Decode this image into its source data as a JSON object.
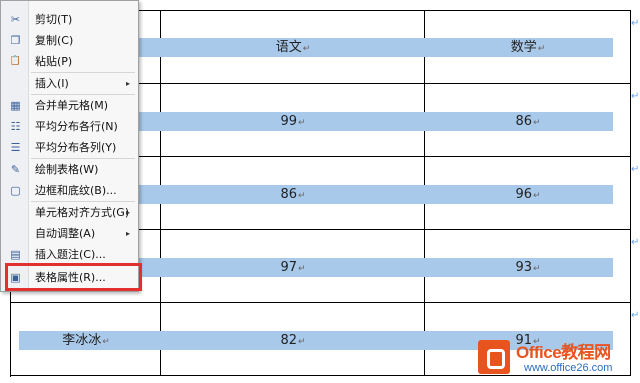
{
  "table": {
    "headers": [
      "语文",
      "数学"
    ],
    "rows": [
      {
        "name": "",
        "chinese": "99",
        "math": "86"
      },
      {
        "name": "",
        "chinese": "86",
        "math": "96"
      },
      {
        "name": "",
        "chinese": "97",
        "math": "93"
      },
      {
        "name": "李冰冰",
        "chinese": "82",
        "math": "91"
      }
    ],
    "cell_mark": "↵"
  },
  "context_menu": {
    "items": [
      {
        "label": "剪切(T)",
        "icon": "scissors-icon",
        "glyph": "✂"
      },
      {
        "label": "复制(C)",
        "icon": "copy-icon",
        "glyph": "❐"
      },
      {
        "label": "粘贴(P)",
        "icon": "paste-icon",
        "glyph": "📋"
      },
      {
        "label": "插入(I)",
        "icon": "",
        "glyph": "",
        "submenu": "▸"
      },
      {
        "label": "合并单元格(M)",
        "icon": "merge-cells-icon",
        "glyph": "▦"
      },
      {
        "label": "平均分布各行(N)",
        "icon": "distribute-rows-icon",
        "glyph": "☷"
      },
      {
        "label": "平均分布各列(Y)",
        "icon": "distribute-columns-icon",
        "glyph": "☰"
      },
      {
        "label": "绘制表格(W)",
        "icon": "draw-table-icon",
        "glyph": "✎"
      },
      {
        "label": "边框和底纹(B)...",
        "icon": "borders-shading-icon",
        "glyph": "▢"
      },
      {
        "label": "单元格对齐方式(G)",
        "icon": "",
        "glyph": "",
        "submenu": "▸"
      },
      {
        "label": "自动调整(A)",
        "icon": "",
        "glyph": "",
        "submenu": "▸"
      },
      {
        "label": "插入题注(C)...",
        "icon": "insert-caption-icon",
        "glyph": "▤"
      },
      {
        "label": "表格属性(R)...",
        "icon": "table-properties-icon",
        "glyph": "▣"
      }
    ]
  },
  "watermark": {
    "brand": "Office教程网",
    "url": "www.office26.com"
  }
}
